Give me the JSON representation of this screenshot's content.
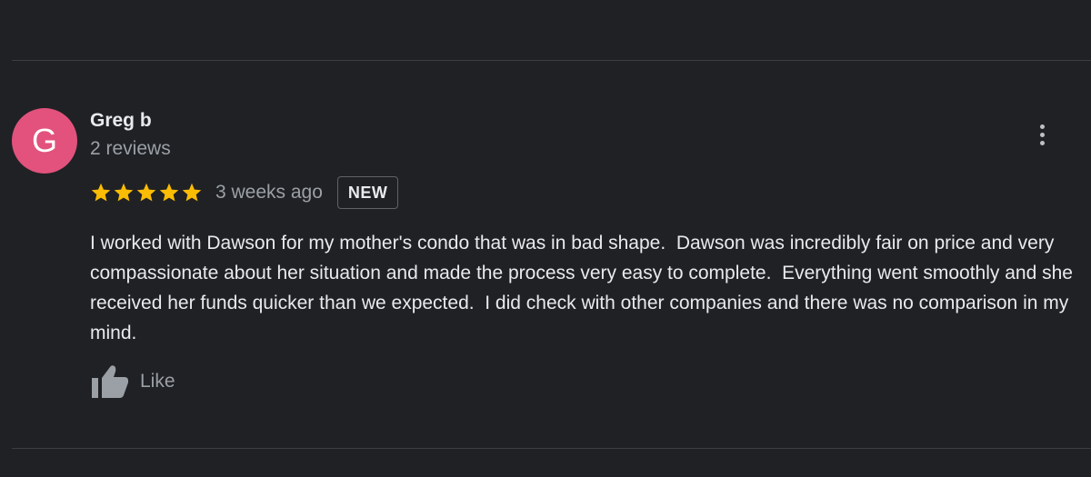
{
  "review": {
    "avatar_letter": "G",
    "avatar_color": "#e2527d",
    "author_name": "Greg b",
    "review_count": "2 reviews",
    "rating": 5,
    "rating_max": 5,
    "star_color": "#fbbc04",
    "time_ago": "3 weeks ago",
    "badge": "NEW",
    "text": "I worked with Dawson for my mother's condo that was in bad shape.  Dawson was incredibly fair on price and very compassionate about her situation and made the process very easy to complete.  Everything went smoothly and she received her funds quicker than we expected.  I did check with other companies and there was no comparison in my mind.",
    "like_label": "Like",
    "more_icon": "more-vert-icon",
    "like_icon": "thumbs-up-icon"
  },
  "theme": {
    "background": "#202124",
    "primary_text": "#e8eaed",
    "secondary_text": "#9aa0a6"
  }
}
